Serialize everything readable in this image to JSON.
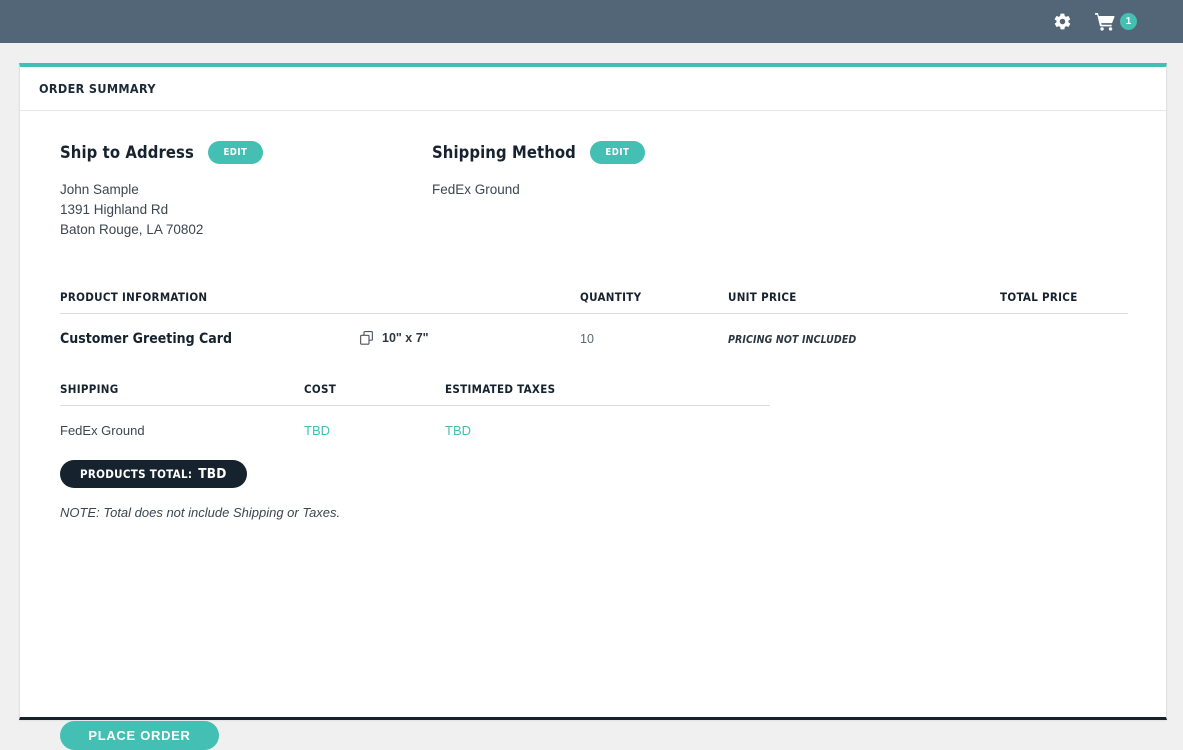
{
  "topbar": {
    "gear_icon": "gear-icon",
    "cart_icon": "shopping-cart-icon",
    "cart_count": "1"
  },
  "card": {
    "title": "ORDER SUMMARY",
    "accent_color": "#44bfb4",
    "dark_color": "#16232f",
    "header_color": "#526678"
  },
  "ship_to": {
    "title": "Ship to Address",
    "edit_label": "EDIT",
    "name": "John Sample",
    "street": "1391 Highland Rd",
    "city_state_zip": "Baton Rouge, LA 70802"
  },
  "shipping_method": {
    "title": "Shipping Method",
    "edit_label": "EDIT",
    "value": "FedEx Ground"
  },
  "product_table": {
    "headers": {
      "product_information": "PRODUCT INFORMATION",
      "size": "",
      "quantity": "QUANTITY",
      "unit_price": "UNIT PRICE",
      "total_price": "TOTAL PRICE"
    },
    "rows": [
      {
        "name": "Customer Greeting Card",
        "size_icon": "copy-icon",
        "size": "10\" x 7\"",
        "quantity": "10",
        "unit_price": "PRICING NOT INCLUDED",
        "total_price": ""
      }
    ]
  },
  "shipping_section": {
    "headers": {
      "shipping": "SHIPPING",
      "cost": "COST",
      "estimated_taxes": "ESTIMATED TAXES"
    },
    "values": {
      "shipping": "FedEx Ground",
      "cost": "TBD",
      "estimated_taxes": "TBD"
    }
  },
  "totals": {
    "label": "PRODUCTS TOTAL:",
    "value": "TBD",
    "note": "NOTE: Total does not include Shipping or Taxes."
  },
  "actions": {
    "place_order": "PLACE ORDER"
  }
}
